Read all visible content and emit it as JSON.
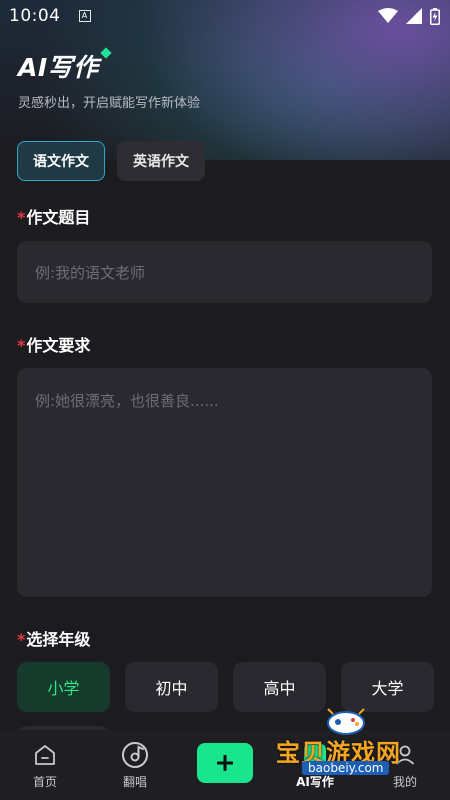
{
  "status_bar": {
    "time": "10:04",
    "notification_glyph": "A"
  },
  "header": {
    "title": "AI写作",
    "subtitle": "灵感秒出，开启赋能写作新体验"
  },
  "essay_types": [
    {
      "label": "语文作文",
      "active": true
    },
    {
      "label": "英语作文",
      "active": false
    }
  ],
  "form": {
    "required_mark": "*",
    "title_label": "作文题目",
    "title_placeholder": "例:我的语文老师",
    "requirement_label": "作文要求",
    "requirement_placeholder": "例:她很漂亮，也很善良......",
    "grade_label": "选择年级",
    "grades": [
      {
        "label": "小学",
        "active": true
      },
      {
        "label": "初中",
        "active": false
      },
      {
        "label": "高中",
        "active": false
      },
      {
        "label": "大学",
        "active": false
      }
    ]
  },
  "bottom_nav": {
    "items": [
      {
        "label": "首页",
        "icon": "home-icon"
      },
      {
        "label": "翻唱",
        "icon": "music-disc-icon"
      },
      {
        "label": "",
        "icon": "plus-icon"
      },
      {
        "label": "AI写作",
        "icon": "ai-write-icon"
      },
      {
        "label": "我的",
        "icon": "profile-icon"
      }
    ]
  },
  "watermark": {
    "text": "宝贝游戏网",
    "url": "baobeiy.com"
  },
  "colors": {
    "accent_green": "#19e58c",
    "active_tab_border": "#2fa6c9",
    "required_red": "#e33b3b"
  }
}
